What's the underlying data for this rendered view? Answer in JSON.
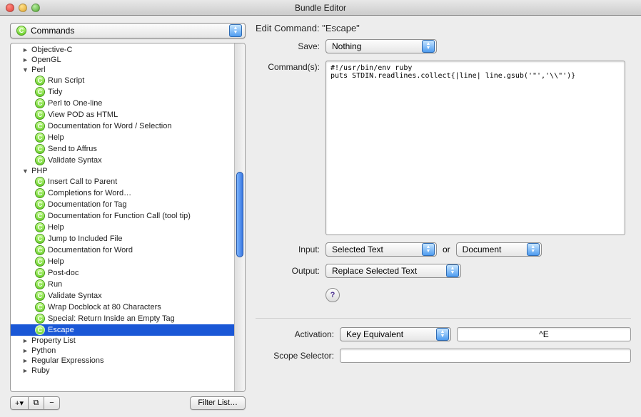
{
  "window": {
    "title": "Bundle Editor"
  },
  "left": {
    "filter_label": "Commands",
    "tree": [
      {
        "kind": "group",
        "label": "Objective-C",
        "state": "closed",
        "level": 1
      },
      {
        "kind": "group",
        "label": "OpenGL",
        "state": "closed",
        "level": 1
      },
      {
        "kind": "group",
        "label": "Perl",
        "state": "open",
        "level": 1
      },
      {
        "kind": "cmd",
        "label": "Run Script",
        "level": 2
      },
      {
        "kind": "cmd",
        "label": "Tidy",
        "level": 2
      },
      {
        "kind": "cmd",
        "label": "Perl to One-line",
        "level": 2
      },
      {
        "kind": "cmd",
        "label": "View POD as HTML",
        "level": 2
      },
      {
        "kind": "cmd",
        "label": "Documentation for Word / Selection",
        "level": 2
      },
      {
        "kind": "cmd",
        "label": "Help",
        "level": 2
      },
      {
        "kind": "cmd",
        "label": "Send to Affrus",
        "level": 2
      },
      {
        "kind": "cmd",
        "label": "Validate Syntax",
        "level": 2
      },
      {
        "kind": "group",
        "label": "PHP",
        "state": "open",
        "level": 1
      },
      {
        "kind": "cmd",
        "label": "Insert Call to Parent",
        "level": 2
      },
      {
        "kind": "cmd",
        "label": "Completions for Word…",
        "level": 2
      },
      {
        "kind": "cmd",
        "label": "Documentation for Tag",
        "level": 2
      },
      {
        "kind": "cmd",
        "label": "Documentation for Function Call (tool tip)",
        "level": 2
      },
      {
        "kind": "cmd",
        "label": "Help",
        "level": 2
      },
      {
        "kind": "cmd",
        "label": "Jump to Included File",
        "level": 2
      },
      {
        "kind": "cmd",
        "label": "Documentation for Word",
        "level": 2
      },
      {
        "kind": "cmd",
        "label": "Help",
        "level": 2
      },
      {
        "kind": "cmd",
        "label": "Post-doc",
        "level": 2
      },
      {
        "kind": "cmd",
        "label": "Run",
        "level": 2
      },
      {
        "kind": "cmd",
        "label": "Validate Syntax",
        "level": 2
      },
      {
        "kind": "cmd",
        "label": "Wrap Docblock at 80 Characters",
        "level": 2
      },
      {
        "kind": "cmd",
        "label": "Special: Return Inside an Empty Tag",
        "level": 2
      },
      {
        "kind": "cmd",
        "label": "Escape",
        "level": 2,
        "selected": true
      },
      {
        "kind": "group",
        "label": "Property List",
        "state": "closed",
        "level": 1
      },
      {
        "kind": "group",
        "label": "Python",
        "state": "closed",
        "level": 1
      },
      {
        "kind": "group",
        "label": "Regular Expressions",
        "state": "closed",
        "level": 1
      },
      {
        "kind": "group",
        "label": "Ruby",
        "state": "closed",
        "level": 1
      }
    ],
    "add_label": "+",
    "dup_label": "⧉",
    "remove_label": "−",
    "filterlist_label": "Filter List…"
  },
  "right": {
    "heading": "Edit Command: \"Escape\"",
    "save_label": "Save:",
    "save_value": "Nothing",
    "commands_label": "Command(s):",
    "command_body": "#!/usr/bin/env ruby\nputs STDIN.readlines.collect{|line| line.gsub('\"','\\\\\"')}",
    "input_label": "Input:",
    "input_value": "Selected Text",
    "input_or": "or",
    "input_alt": "Document",
    "output_label": "Output:",
    "output_value": "Replace Selected Text",
    "help_label": "?",
    "activation_label": "Activation:",
    "activation_value": "Key Equivalent",
    "activation_key": "^E",
    "scope_label": "Scope Selector:",
    "scope_value": ""
  }
}
